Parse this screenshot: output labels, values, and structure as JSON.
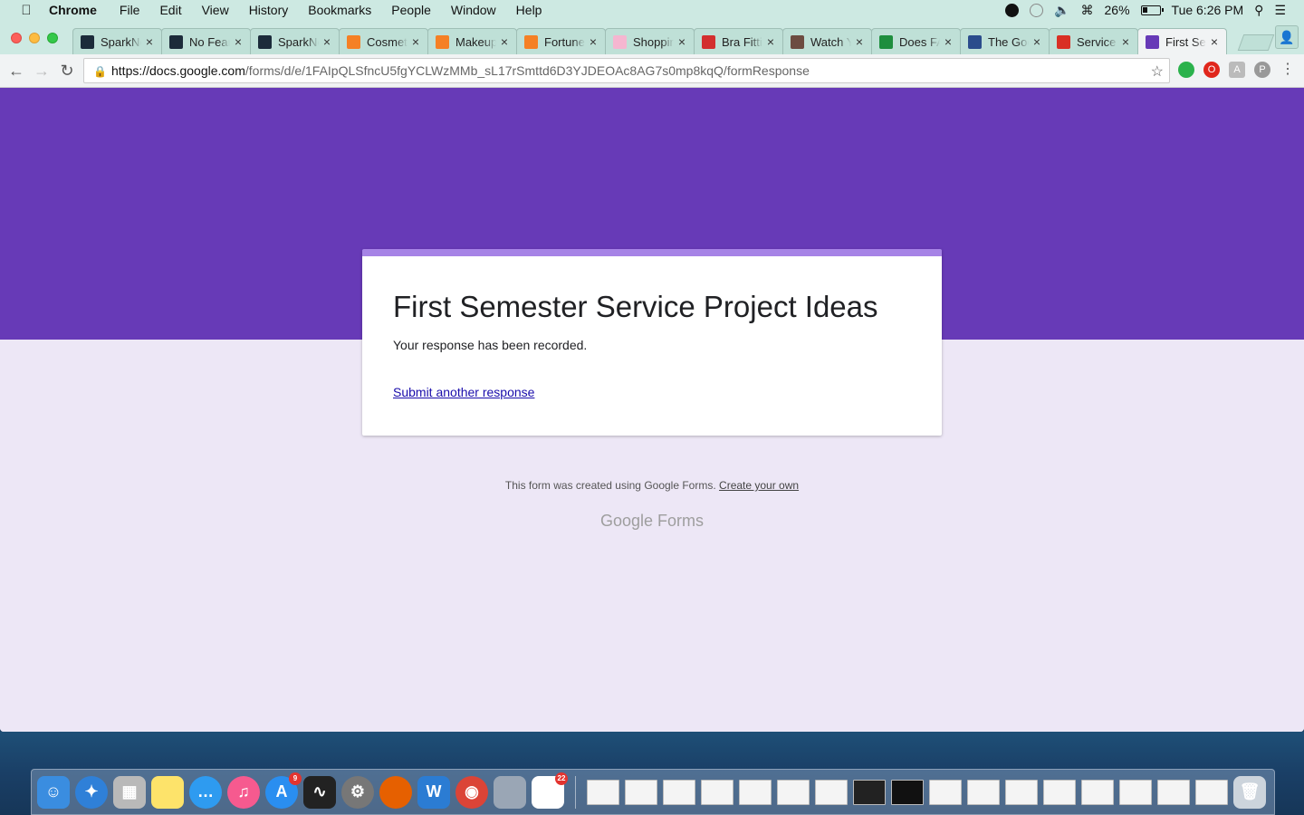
{
  "menubar": {
    "app_name": "Chrome",
    "items": [
      "File",
      "Edit",
      "View",
      "History",
      "Bookmarks",
      "People",
      "Window",
      "Help"
    ],
    "battery": "26%",
    "clock": "Tue 6:26 PM"
  },
  "tabs": [
    {
      "title": "SparkNotes",
      "favicon": "sparknotes-icon",
      "color": "#1c2b3a"
    },
    {
      "title": "No Fear",
      "favicon": "sparknotes-icon",
      "color": "#1c2b3a"
    },
    {
      "title": "SparkNotes",
      "favicon": "sparknotes-icon",
      "color": "#1c2b3a"
    },
    {
      "title": "Cosmetics",
      "favicon": "ulta-icon",
      "color": "#f58025"
    },
    {
      "title": "Makeup",
      "favicon": "ulta-icon",
      "color": "#f58025"
    },
    {
      "title": "Fortune",
      "favicon": "ulta-icon",
      "color": "#f58025"
    },
    {
      "title": "Shopping",
      "favicon": "striped-icon",
      "color": "#f5b6d0"
    },
    {
      "title": "Bra Fitting",
      "favicon": "script-logo-icon",
      "color": "#d32f2f"
    },
    {
      "title": "Watch Y",
      "favicon": "film-icon",
      "color": "#6d4c41"
    },
    {
      "title": "Does FA",
      "favicon": "triangle-icon",
      "color": "#1e8e3e"
    },
    {
      "title": "The Good",
      "favicon": "ntu-icon",
      "color": "#2b4c8c"
    },
    {
      "title": "Service",
      "favicon": "gmail-icon",
      "color": "#d93025"
    },
    {
      "title": "First Semester",
      "favicon": "forms-icon",
      "color": "#673ab7"
    }
  ],
  "address_bar": {
    "host": "https://docs.google.com",
    "path": "/forms/d/e/1FAIpQLSfncU5fgYCLWzMMb_sL17rSmttd6D3YJDEOAc8AG7s0mp8kqQ/formResponse"
  },
  "form": {
    "title": "First Semester Service Project Ideas",
    "confirmation": "Your response has been recorded.",
    "submit_another": "Submit another response",
    "theme_color": "#673ab7",
    "background_color": "#ede7f6"
  },
  "footer": {
    "note": "This form was created using Google Forms.",
    "create_link": "Create your own",
    "brand": "Google Forms"
  },
  "dock": {
    "badges": {
      "app_store": "9",
      "reminders": "22"
    }
  }
}
